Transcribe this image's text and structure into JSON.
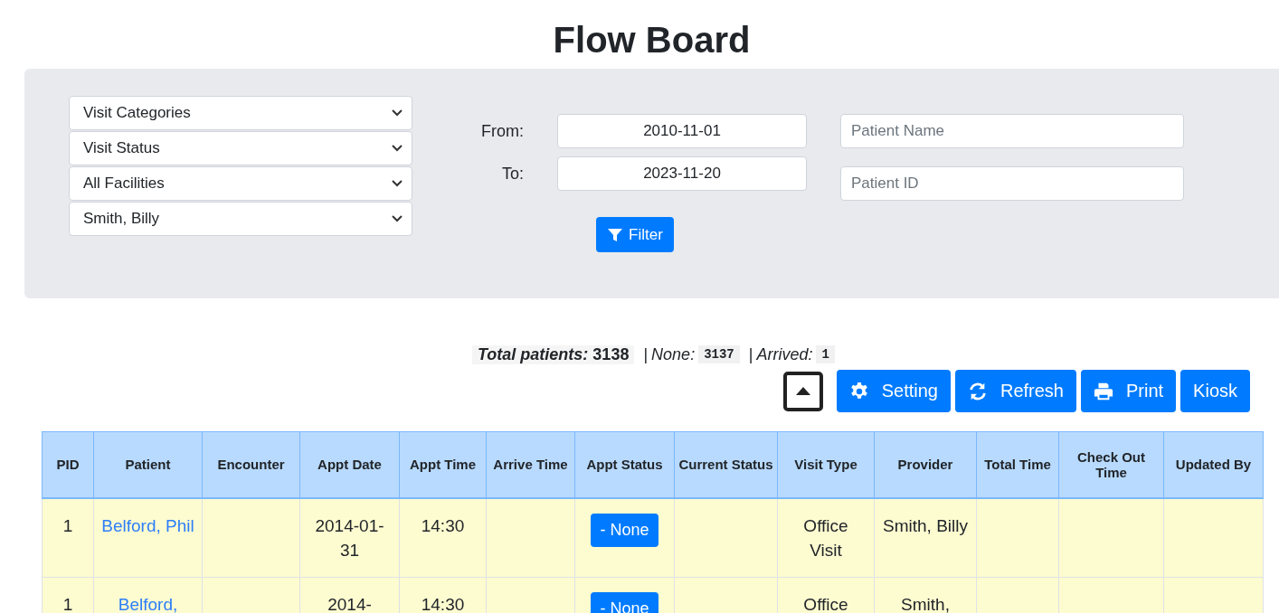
{
  "title": "Flow Board",
  "filters": {
    "selects": [
      "Visit Categories",
      "Visit Status",
      "All Facilities",
      "Smith, Billy"
    ],
    "from_label": "From:",
    "from_value": "2010-11-01",
    "to_label": "To:",
    "to_value": "2023-11-20",
    "patient_name": {
      "placeholder": "Patient Name"
    },
    "patient_id": {
      "placeholder": "Patient ID"
    },
    "filter_button": "Filter"
  },
  "stats": {
    "total_label": "Total patients:",
    "total": "3138",
    "items": [
      {
        "separator": "|",
        "label": "None:",
        "count": "3137"
      },
      {
        "separator": "|",
        "label": "Arrived:",
        "count": "1"
      }
    ]
  },
  "toolbar": [
    "Setting",
    "Refresh",
    "Print",
    "Kiosk"
  ],
  "table": {
    "columns": [
      "PID",
      "Patient",
      "Encounter",
      "Appt Date",
      "Appt Time",
      "Arrive Time",
      "Appt Status",
      "Current Status",
      "Visit Type",
      "Provider",
      "Total Time",
      "Check Out Time",
      "Updated By"
    ],
    "rows": [
      {
        "pid": "1",
        "patient": "Belford, Phil",
        "encounter": "",
        "appt_date": "2014-01-31",
        "appt_time": "14:30",
        "arrive_time": "",
        "appt_status": "- None",
        "current_status": "",
        "visit_type": "Office Visit",
        "provider": "Smith, Billy",
        "total_time": "",
        "check_out_time": "",
        "updated_by": ""
      },
      {
        "pid": "1",
        "patient": "Belford,",
        "encounter": "",
        "appt_date": "2014-",
        "appt_time": "14:30",
        "arrive_time": "",
        "appt_status": "- None",
        "current_status": "",
        "visit_type": "Office",
        "provider": "Smith,",
        "total_time": "",
        "check_out_time": "",
        "updated_by": ""
      }
    ]
  }
}
